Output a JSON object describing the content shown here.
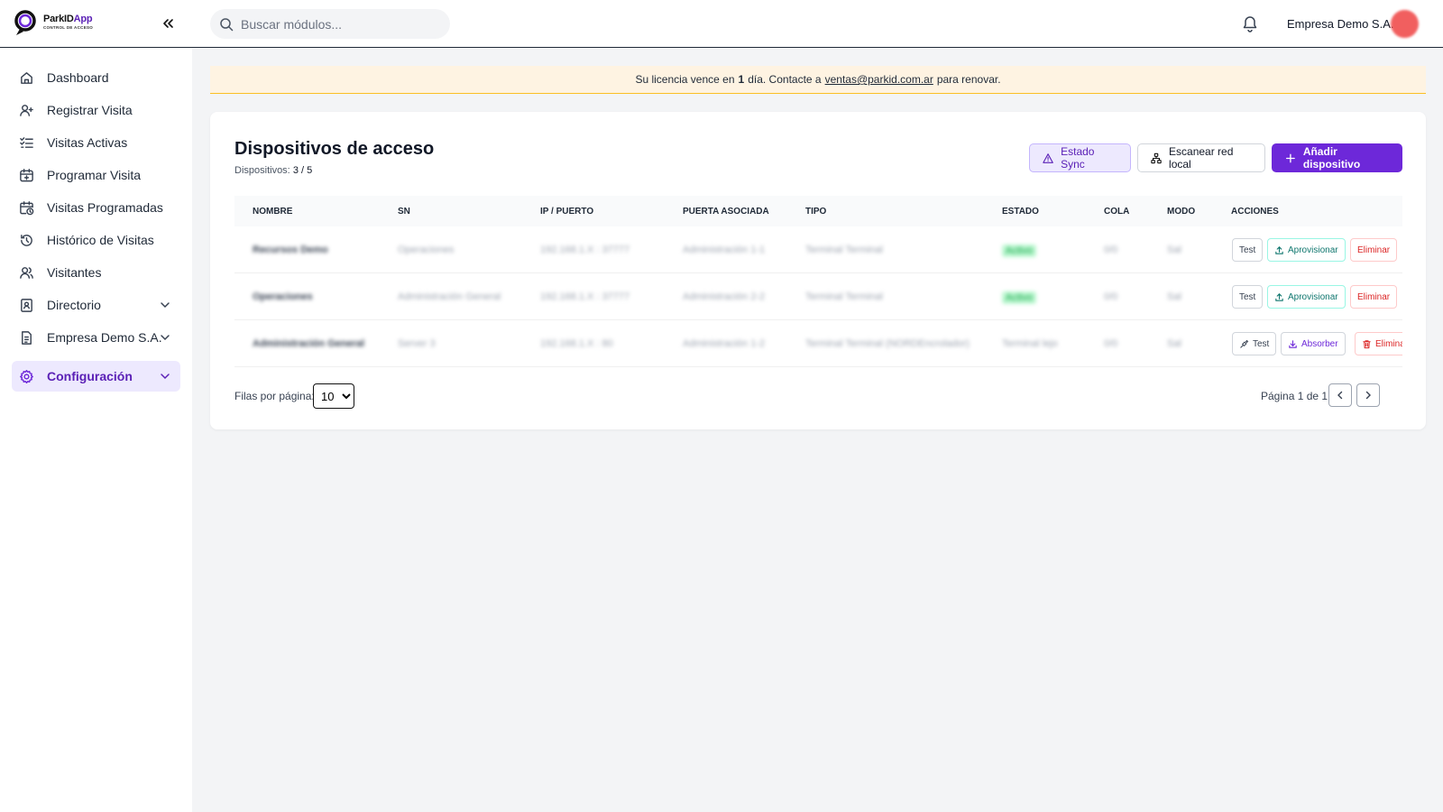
{
  "brand": {
    "name_part1": "ParkID",
    "name_part2": "App",
    "tagline": "CONTROL DE ACCESO"
  },
  "header": {
    "search_placeholder": "Buscar módulos...",
    "company": "Empresa Demo S.A."
  },
  "sidebar": {
    "items": [
      {
        "label": "Dashboard",
        "icon": "home-icon"
      },
      {
        "label": "Registrar Visita",
        "icon": "user-plus-icon"
      },
      {
        "label": "Visitas Activas",
        "icon": "list-check-icon"
      },
      {
        "label": "Programar Visita",
        "icon": "calendar-plus-icon"
      },
      {
        "label": "Visitas Programadas",
        "icon": "calendar-clock-icon"
      },
      {
        "label": "Histórico de Visitas",
        "icon": "history-icon"
      },
      {
        "label": "Visitantes",
        "icon": "users-icon"
      },
      {
        "label": "Directorio",
        "icon": "book-icon"
      },
      {
        "label": "Empresa Demo S.A.",
        "icon": "document-icon"
      },
      {
        "label": "Configuración",
        "icon": "gear-icon"
      }
    ]
  },
  "banner": {
    "prefix": "Su licencia vence en",
    "days": "1",
    "middle": "día. Contacte a",
    "email": "ventas@parkid.com.ar",
    "suffix": "para renovar."
  },
  "page": {
    "title": "Dispositivos de acceso",
    "count_label": "Dispositivos:",
    "count_value": "3 / 5",
    "btn_sync": "Estado Sync",
    "btn_scan": "Escanear red local",
    "btn_add": "Añadir dispositivo"
  },
  "table": {
    "columns": [
      "NOMBRE",
      "SN",
      "IP / PUERTO",
      "PUERTA ASOCIADA",
      "TIPO",
      "ESTADO",
      "COLA",
      "MODO",
      "ACCIONES"
    ],
    "rows": [
      {
        "nombre": "Recursos Demo",
        "sn": "Operaciones",
        "ip": "192.168.1.X : 37777",
        "puerta": "Administración 1-1",
        "tipo": "Terminal Terminal",
        "estado": "Activo",
        "cola": "0/0",
        "modo": "Sal",
        "actions": [
          "Test",
          "Aprovisionar",
          "Eliminar"
        ]
      },
      {
        "nombre": "Operaciones",
        "sn": "Administración General",
        "ip": "192.168.1.X : 37777",
        "puerta": "Administración 2-2",
        "tipo": "Terminal Terminal",
        "estado": "Activo",
        "cola": "0/0",
        "modo": "Sal",
        "actions": [
          "Test",
          "Aprovisionar",
          "Eliminar"
        ]
      },
      {
        "nombre": "Administración General",
        "sn": "Server 3",
        "ip": "192.168.1.X : 80",
        "puerta": "Administración 1-2",
        "tipo": "Terminal Terminal (NORDEncrolador)",
        "estado": "Terminal lejo",
        "cola": "0/0",
        "modo": "Sal",
        "actions": [
          "Test",
          "Absorber",
          "Eliminar"
        ]
      }
    ]
  },
  "pager": {
    "rows_label": "Filas por página:",
    "rows_value": "10",
    "page_info": "Página 1 de 1"
  },
  "colors": {
    "accent": "#6d28d9",
    "accent_light": "#ede9fe",
    "banner_bg": "#fef3e2"
  }
}
